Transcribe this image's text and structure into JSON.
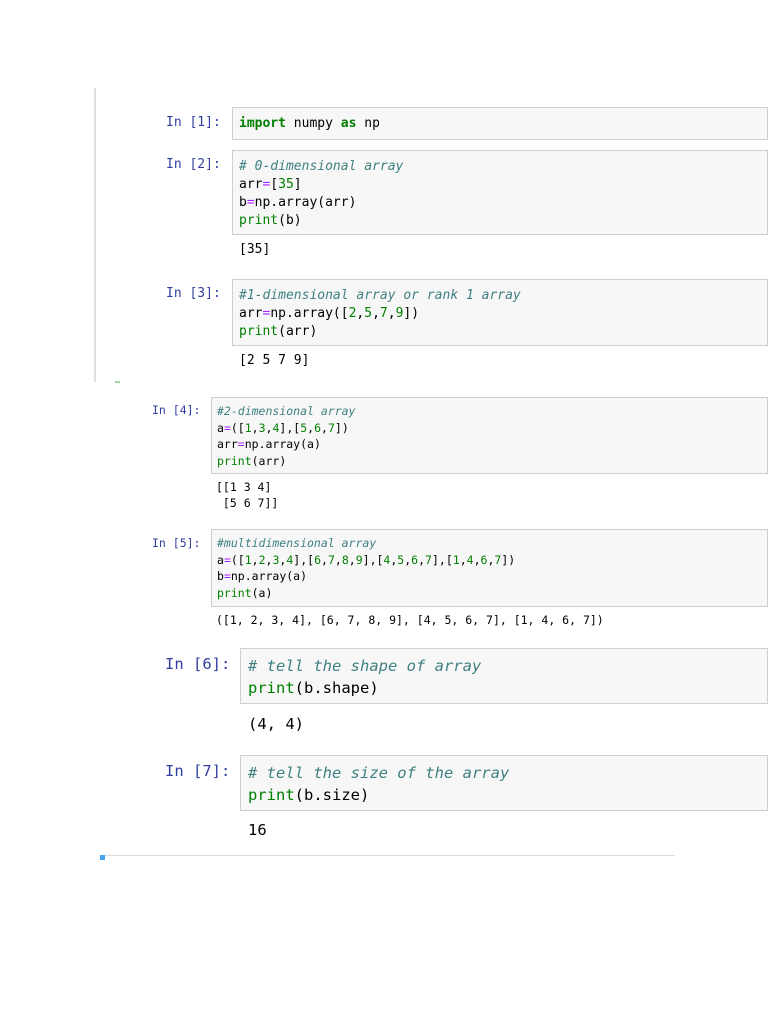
{
  "cells": [
    {
      "prompt": "In [1]:",
      "code": [
        [
          [
            "kw",
            "import"
          ],
          [
            "t",
            " numpy "
          ],
          [
            "kw",
            "as"
          ],
          [
            "t",
            " np"
          ]
        ]
      ],
      "output": ""
    },
    {
      "prompt": "In [2]:",
      "code": [
        [
          [
            "cm",
            "# 0-dimensional array"
          ]
        ],
        [
          [
            "t",
            "arr"
          ],
          [
            "op",
            "="
          ],
          [
            "t",
            "["
          ],
          [
            "num",
            "35"
          ],
          [
            "t",
            "]"
          ]
        ],
        [
          [
            "t",
            "b"
          ],
          [
            "op",
            "="
          ],
          [
            "t",
            "np.array(arr)"
          ]
        ],
        [
          [
            "bi",
            "print"
          ],
          [
            "t",
            "(b)"
          ]
        ]
      ],
      "output": "[35]"
    },
    {
      "prompt": "In [3]:",
      "code": [
        [
          [
            "cm",
            "#1-dimensional array or rank 1 array"
          ]
        ],
        [
          [
            "t",
            "arr"
          ],
          [
            "op",
            "="
          ],
          [
            "t",
            "np.array(["
          ],
          [
            "num",
            "2"
          ],
          [
            "t",
            ","
          ],
          [
            "num",
            "5"
          ],
          [
            "t",
            ","
          ],
          [
            "num",
            "7"
          ],
          [
            "t",
            ","
          ],
          [
            "num",
            "9"
          ],
          [
            "t",
            "])"
          ]
        ],
        [
          [
            "bi",
            "print"
          ],
          [
            "t",
            "(arr)"
          ]
        ]
      ],
      "output": "[2 5 7 9]"
    },
    {
      "prompt": "In [4]:",
      "code": [
        [
          [
            "cm",
            "#2-dimensional array"
          ]
        ],
        [
          [
            "t",
            "a"
          ],
          [
            "op",
            "="
          ],
          [
            "t",
            "(["
          ],
          [
            "num",
            "1"
          ],
          [
            "t",
            ","
          ],
          [
            "num",
            "3"
          ],
          [
            "t",
            ","
          ],
          [
            "num",
            "4"
          ],
          [
            "t",
            "],["
          ],
          [
            "num",
            "5"
          ],
          [
            "t",
            ","
          ],
          [
            "num",
            "6"
          ],
          [
            "t",
            ","
          ],
          [
            "num",
            "7"
          ],
          [
            "t",
            "])"
          ]
        ],
        [
          [
            "t",
            "arr"
          ],
          [
            "op",
            "="
          ],
          [
            "t",
            "np.array(a)"
          ]
        ],
        [
          [
            "bi",
            "print"
          ],
          [
            "t",
            "(arr)"
          ]
        ]
      ],
      "output": "[[1 3 4]\n [5 6 7]]"
    },
    {
      "prompt": "In [5]:",
      "code": [
        [
          [
            "cm",
            "#multidimensional array"
          ]
        ],
        [
          [
            "t",
            "a"
          ],
          [
            "op",
            "="
          ],
          [
            "t",
            "(["
          ],
          [
            "num",
            "1"
          ],
          [
            "t",
            ","
          ],
          [
            "num",
            "2"
          ],
          [
            "t",
            ","
          ],
          [
            "num",
            "3"
          ],
          [
            "t",
            ","
          ],
          [
            "num",
            "4"
          ],
          [
            "t",
            "],["
          ],
          [
            "num",
            "6"
          ],
          [
            "t",
            ","
          ],
          [
            "num",
            "7"
          ],
          [
            "t",
            ","
          ],
          [
            "num",
            "8"
          ],
          [
            "t",
            ","
          ],
          [
            "num",
            "9"
          ],
          [
            "t",
            "],["
          ],
          [
            "num",
            "4"
          ],
          [
            "t",
            ","
          ],
          [
            "num",
            "5"
          ],
          [
            "t",
            ","
          ],
          [
            "num",
            "6"
          ],
          [
            "t",
            ","
          ],
          [
            "num",
            "7"
          ],
          [
            "t",
            "],["
          ],
          [
            "num",
            "1"
          ],
          [
            "t",
            ","
          ],
          [
            "num",
            "4"
          ],
          [
            "t",
            ","
          ],
          [
            "num",
            "6"
          ],
          [
            "t",
            ","
          ],
          [
            "num",
            "7"
          ],
          [
            "t",
            "])"
          ]
        ],
        [
          [
            "t",
            "b"
          ],
          [
            "op",
            "="
          ],
          [
            "t",
            "np.array(a)"
          ]
        ],
        [
          [
            "bi",
            "print"
          ],
          [
            "t",
            "(a)"
          ]
        ]
      ],
      "output": "([1, 2, 3, 4], [6, 7, 8, 9], [4, 5, 6, 7], [1, 4, 6, 7])"
    },
    {
      "prompt": "In [6]:",
      "code": [
        [
          [
            "cm",
            "# tell the shape of array"
          ]
        ],
        [
          [
            "bi",
            "print"
          ],
          [
            "t",
            "(b.shape)"
          ]
        ]
      ],
      "output": "(4, 4)"
    },
    {
      "prompt": "In [7]:",
      "code": [
        [
          [
            "cm",
            "# tell the size of the array"
          ]
        ],
        [
          [
            "bi",
            "print"
          ],
          [
            "t",
            "(b.size)"
          ]
        ]
      ],
      "output": "16"
    }
  ]
}
